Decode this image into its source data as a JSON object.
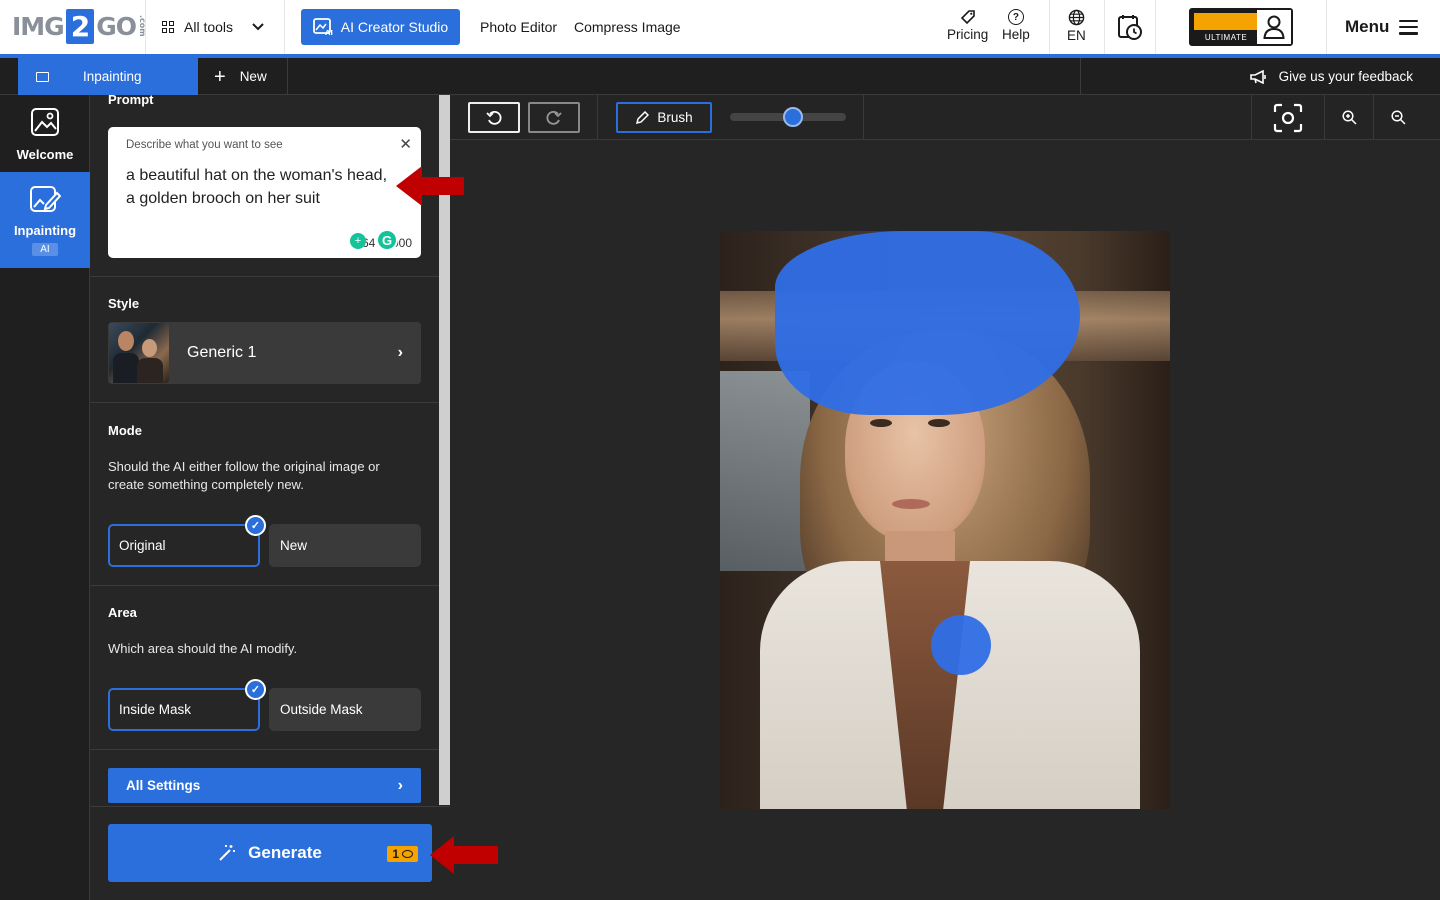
{
  "nav": {
    "logo_left": "IMG",
    "logo_mid": "2",
    "logo_right": "GO",
    "logo_suffix": ".com",
    "all_tools": "All tools",
    "creator_studio": "AI Creator Studio",
    "links": [
      "Photo Editor",
      "Compress Image"
    ],
    "pricing": "Pricing",
    "help": "Help",
    "lang": "EN",
    "plan_label": "ULTIMATE",
    "menu": "Menu"
  },
  "tabs": {
    "active": "Inpainting",
    "new": "New",
    "feedback": "Give us your feedback"
  },
  "rail": {
    "welcome": "Welcome",
    "inpainting": "Inpainting",
    "badge": "AI"
  },
  "panel": {
    "prompt_title": "Prompt",
    "prompt_placeholder": "Describe what you want to see",
    "prompt_value": "a beautiful hat on the woman's head, a golden brooch on her suit",
    "prompt_count": "64 / 1000",
    "style_title": "Style",
    "style_value": "Generic 1",
    "mode_title": "Mode",
    "mode_desc": "Should the AI either follow the original image or create something completely new.",
    "mode_options": [
      "Original",
      "New"
    ],
    "mode_selected": "Original",
    "area_title": "Area",
    "area_desc": "Which area should the AI modify.",
    "area_options": [
      "Inside Mask",
      "Outside Mask"
    ],
    "area_selected": "Inside Mask",
    "all_settings": "All Settings",
    "generate": "Generate",
    "credits": "1"
  },
  "toolbar": {
    "brush": "Brush",
    "brush_size": 0.55
  },
  "icons": [
    "grid-icon",
    "image-icon",
    "tag-icon",
    "help-icon",
    "globe-icon",
    "clock-icon",
    "user-icon",
    "menu-icon",
    "plus-icon",
    "megaphone-icon",
    "undo-icon",
    "redo-icon",
    "pencil-icon",
    "focus-icon",
    "zoom-in-icon",
    "zoom-out-icon",
    "wand-icon",
    "coin-icon",
    "close-icon",
    "chevron-right-icon",
    "check-icon"
  ],
  "colors": {
    "accent": "#2a6fdb",
    "mask": "#2f6ee6",
    "credit": "#f5a300",
    "arrow": "#c00000"
  }
}
